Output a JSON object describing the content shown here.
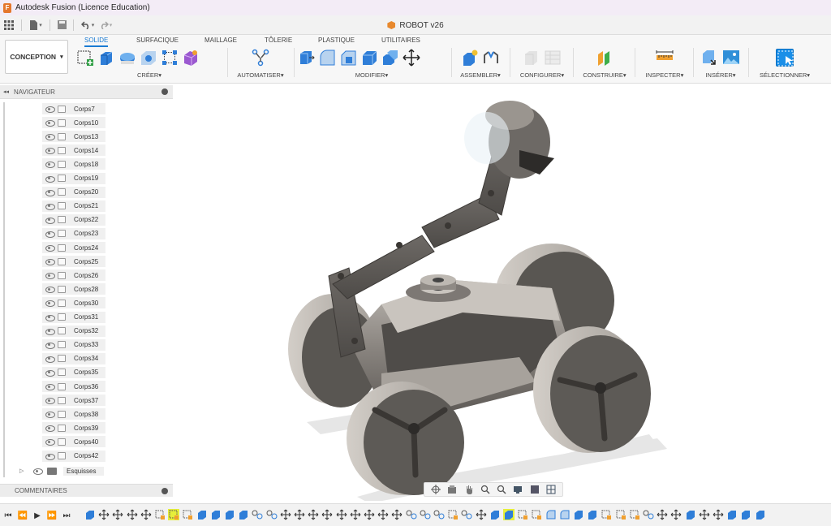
{
  "window": {
    "app_title": "Autodesk Fusion (Licence Education)",
    "app_icon_letter": "F",
    "document_title": "ROBOT v26"
  },
  "quick_access": {
    "grid_icon": "grid-icon",
    "file_icon": "file-icon",
    "save_icon": "save-icon",
    "undo_icon": "undo-icon",
    "redo_icon": "redo-icon"
  },
  "ribbon": {
    "workspace": "CONCEPTION",
    "tabs": [
      "SOLIDE",
      "SURFACIQUE",
      "MAILLAGE",
      "TÔLERIE",
      "PLASTIQUE",
      "UTILITAIRES"
    ],
    "active_tab": "SOLIDE",
    "groups": {
      "creer": "CRÉER",
      "automatiser": "AUTOMATISER",
      "modifier": "MODIFIER",
      "assembler": "ASSEMBLER",
      "configurer": "CONFIGURER",
      "construire": "CONSTRUIRE",
      "inspecter": "INSPECTER",
      "inserer": "INSÉRER",
      "selectionner": "SÉLECTIONNER"
    },
    "caret": "▾"
  },
  "navigator": {
    "title": "NAVIGATEUR",
    "collapse_glyph": "◂◂",
    "bodies": [
      "Corps7",
      "Corps10",
      "Corps13",
      "Corps14",
      "Corps18",
      "Corps19",
      "Corps20",
      "Corps21",
      "Corps22",
      "Corps23",
      "Corps24",
      "Corps25",
      "Corps26",
      "Corps28",
      "Corps30",
      "Corps31",
      "Corps32",
      "Corps33",
      "Corps34",
      "Corps35",
      "Corps36",
      "Corps37",
      "Corps38",
      "Corps39",
      "Corps40",
      "Corps42"
    ],
    "sketches_folder": "Esquisses"
  },
  "comments_panel": {
    "title": "COMMENTAIRES"
  },
  "colors": {
    "accent": "#1b7bd3",
    "app_orange": "#e4772b",
    "model_body": "#8a8580",
    "model_light": "#c9c4be",
    "timeline_highlight": "#e6ef3a"
  }
}
